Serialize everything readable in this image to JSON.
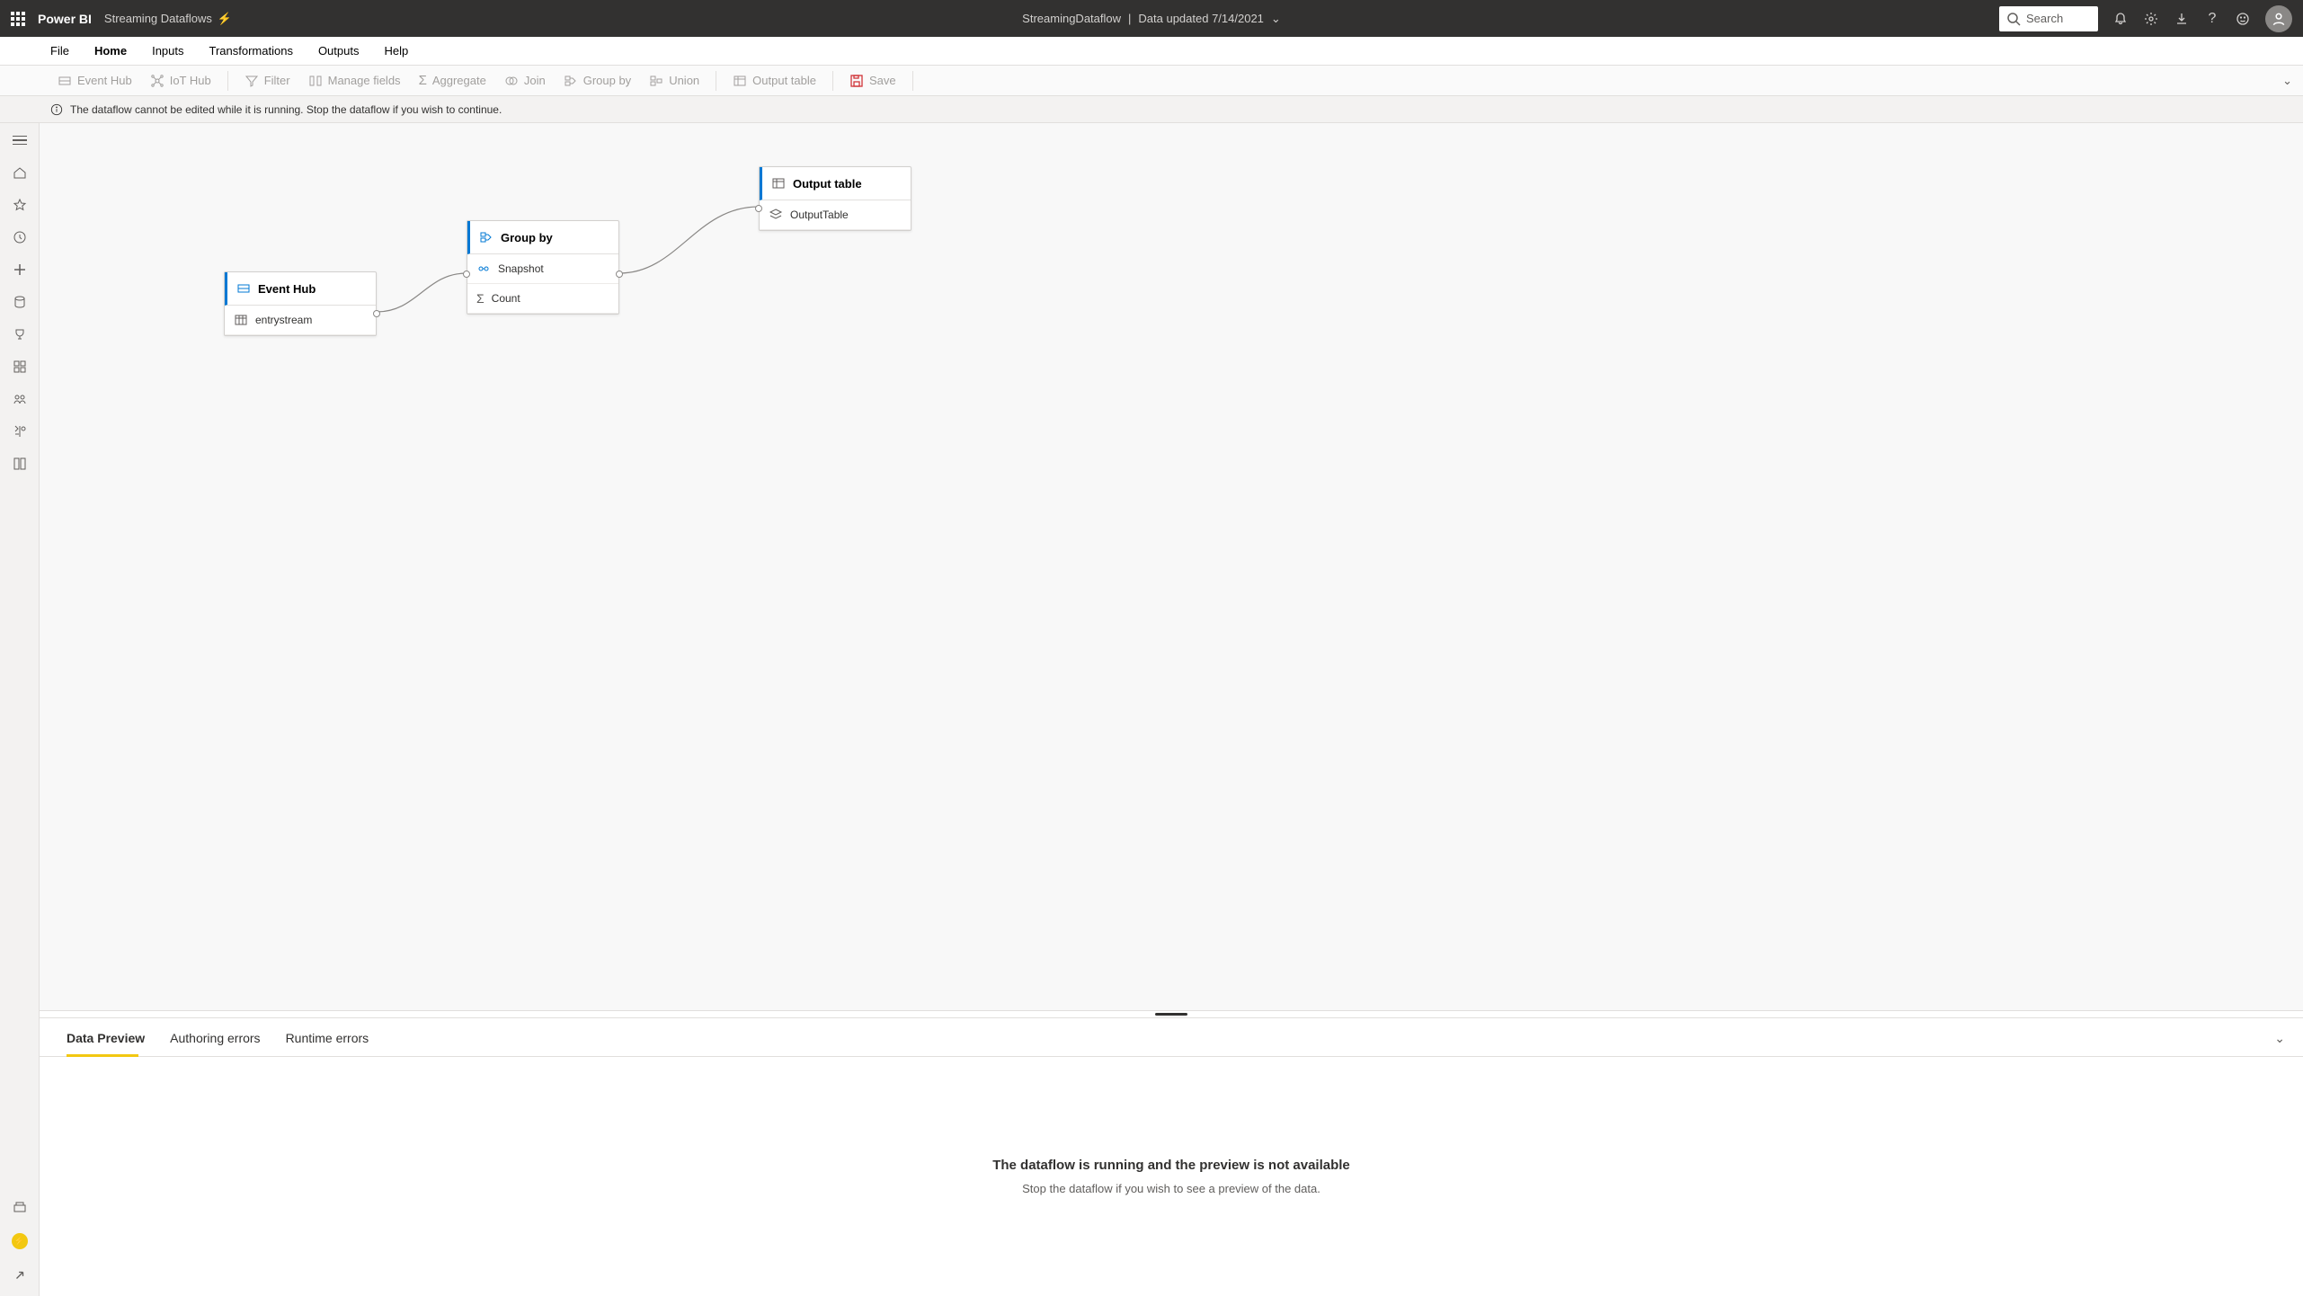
{
  "topbar": {
    "brand": "Power BI",
    "sub": "Streaming Dataflows",
    "center_title": "StreamingDataflow",
    "center_updated": "Data updated 7/14/2021",
    "search_placeholder": "Search"
  },
  "menu": {
    "items": [
      "File",
      "Home",
      "Inputs",
      "Transformations",
      "Outputs",
      "Help"
    ],
    "active": "Home"
  },
  "ribbon": {
    "event_hub": "Event Hub",
    "iot_hub": "IoT Hub",
    "filter": "Filter",
    "manage_fields": "Manage fields",
    "aggregate": "Aggregate",
    "join": "Join",
    "group_by": "Group by",
    "union": "Union",
    "output_table": "Output table",
    "save": "Save"
  },
  "notice": "The dataflow cannot be edited while it is running. Stop the dataflow if you wish to continue.",
  "nodes": {
    "event_hub": {
      "title": "Event Hub",
      "row1": "entrystream"
    },
    "group_by": {
      "title": "Group by",
      "row1": "Snapshot",
      "row2": "Count"
    },
    "output_table": {
      "title": "Output table",
      "row1": "OutputTable"
    }
  },
  "panel": {
    "tabs": [
      "Data Preview",
      "Authoring errors",
      "Runtime errors"
    ],
    "active": "Data Preview",
    "empty_title": "The dataflow is running and the preview is not available",
    "empty_sub": "Stop the dataflow if you wish to see a preview of the data."
  }
}
